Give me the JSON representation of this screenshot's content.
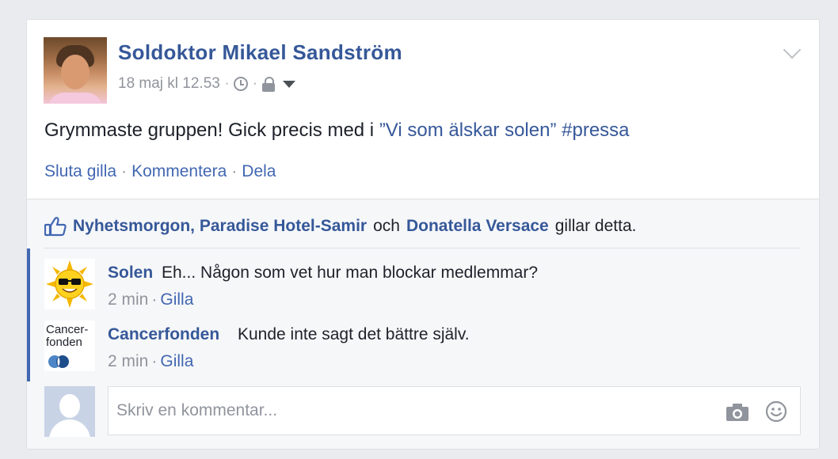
{
  "post": {
    "author": "Soldoktor Mikael Sandström",
    "timestamp": "18 maj kl 12.53",
    "meta_separator": "·",
    "text_prefix": "Grymmaste gruppen! Gick precis med i ",
    "text_group": "”Vi som älskar solen”",
    "text_hashtag": "#pressa",
    "actions": {
      "unlike": "Sluta gilla",
      "comment": "Kommentera",
      "share": "Dela",
      "separator": "·"
    }
  },
  "likes": {
    "liker_1": "Nyhetsmorgon, Paradise Hotel-Samir",
    "conjunction": "och",
    "liker_2": "Donatella Versace",
    "suffix": "gillar detta."
  },
  "comments": [
    {
      "author": "Solen",
      "text": "Eh... Någon som vet hur man blockar medlemmar?",
      "time": "2 min",
      "separator": "·",
      "like_label": "Gilla",
      "avatar_icon": "sun-with-sunglasses-icon"
    },
    {
      "author": "Cancerfonden",
      "text": "Kunde inte sagt det bättre själv.",
      "time": "2 min",
      "separator": "·",
      "like_label": "Gilla",
      "avatar_line_1": "Cancer-",
      "avatar_line_2": "fonden"
    }
  ],
  "composer": {
    "placeholder": "Skriv en kommentar..."
  },
  "colors": {
    "link_blue": "#365899",
    "action_blue": "#4267b2",
    "meta_gray": "#90949c",
    "text": "#1d2129",
    "background": "#e9ebee"
  }
}
